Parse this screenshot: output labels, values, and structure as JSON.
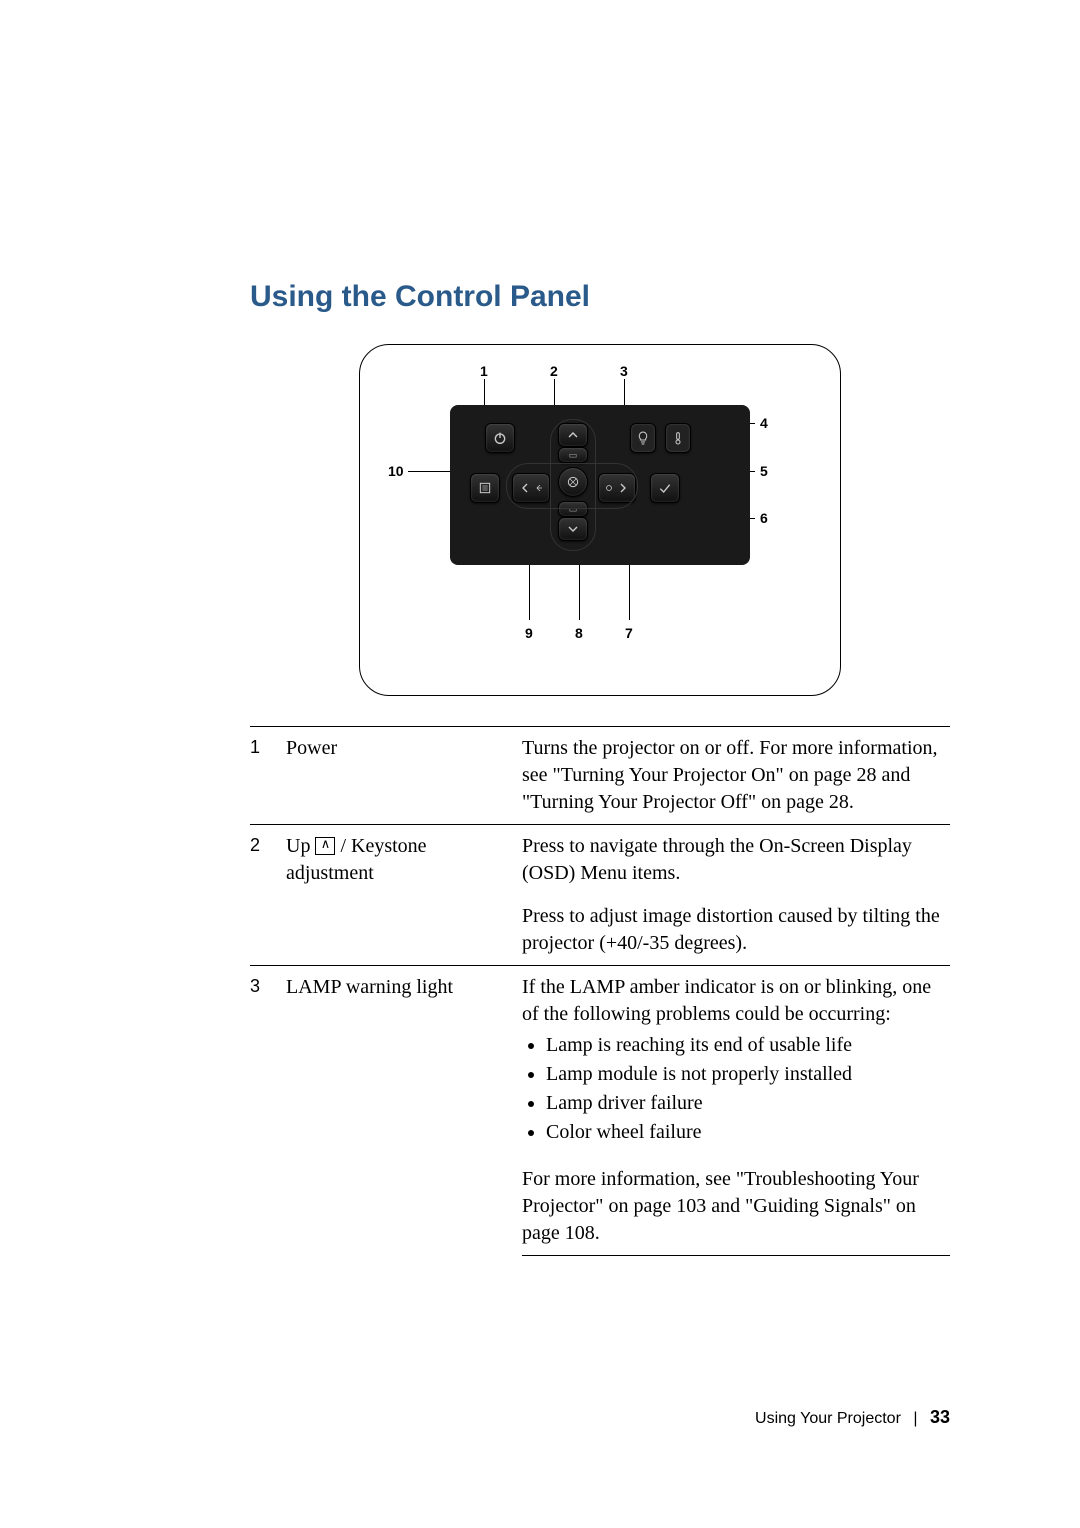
{
  "heading": "Using the Control Panel",
  "callouts": {
    "1": "1",
    "2": "2",
    "3": "3",
    "4": "4",
    "5": "5",
    "6": "6",
    "7": "7",
    "8": "8",
    "9": "9",
    "10": "10"
  },
  "table": {
    "row1": {
      "num": "1",
      "label": "Power",
      "desc": "Turns the projector on or off. For more information, see \"Turning Your Projector On\" on page 28 and \"Turning Your Projector Off\" on page 28."
    },
    "row2": {
      "num": "2",
      "label_pre": "Up ",
      "label_post": " / Keystone adjustment",
      "desc1": "Press to navigate through the On-Screen Display (OSD) Menu items.",
      "desc2": "Press to adjust image distortion caused by tilting the projector (+40/-35 degrees)."
    },
    "row3": {
      "num": "3",
      "label": "LAMP warning light",
      "desc_intro": "If the LAMP amber indicator is on or blinking, one of the following problems could be occurring:",
      "b1": "Lamp is reaching its end of usable life",
      "b2": "Lamp module is not properly installed",
      "b3": "Lamp driver failure",
      "b4": "Color wheel failure",
      "desc_more": "For more information, see \"Troubleshooting Your Projector\" on page 103 and \"Guiding Signals\" on page 108."
    }
  },
  "footer": {
    "text": "Using Your Projector",
    "page": "33"
  }
}
